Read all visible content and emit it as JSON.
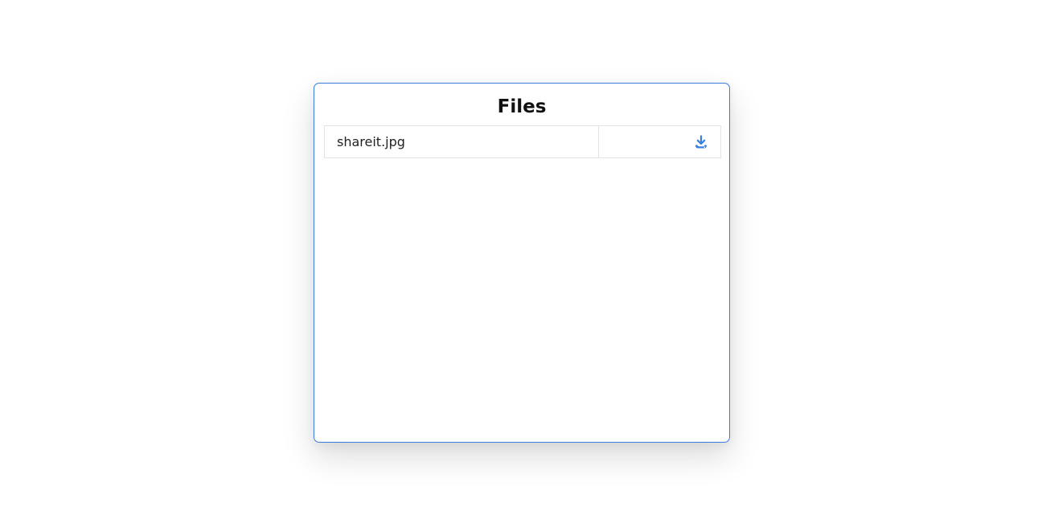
{
  "panel": {
    "title": "Files"
  },
  "files": [
    {
      "name": "shareit.jpg",
      "action_icon": "download-icon"
    }
  ],
  "colors": {
    "accent": "#3b7ddd",
    "border": "#e3e3e3",
    "text": "#222222"
  }
}
